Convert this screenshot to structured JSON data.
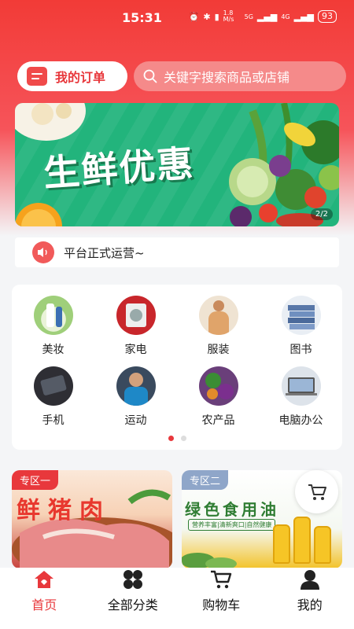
{
  "status_bar": {
    "time": "15:31",
    "network_speed": "1.8 M/s",
    "network_type": "5G",
    "network_type_2": "4G",
    "battery": "93"
  },
  "header": {
    "order_button_label": "我的订单",
    "search_placeholder": "关键字搜索商品或店铺"
  },
  "banner": {
    "title": "生鲜优惠",
    "page_indicator": "2/2"
  },
  "notice": {
    "text": "平台正式运营~"
  },
  "categories": [
    {
      "label": "美妆",
      "icon": "cosmetics-image"
    },
    {
      "label": "家电",
      "icon": "appliance-image"
    },
    {
      "label": "服装",
      "icon": "clothing-image"
    },
    {
      "label": "图书",
      "icon": "books-image"
    },
    {
      "label": "手机",
      "icon": "phone-image"
    },
    {
      "label": "运动",
      "icon": "sports-image"
    },
    {
      "label": "农产品",
      "icon": "produce-image"
    },
    {
      "label": "电脑办公",
      "icon": "computer-image"
    }
  ],
  "zones": [
    {
      "tag": "专区一",
      "title": "鲜猪肉"
    },
    {
      "tag": "专区二",
      "title": "绿色食用油",
      "subtitle": "营养丰富|清新爽口|自然健康"
    }
  ],
  "tab_bar": [
    {
      "label": "首页",
      "icon": "home-icon",
      "active": true
    },
    {
      "label": "全部分类",
      "icon": "grid-icon"
    },
    {
      "label": "购物车",
      "icon": "cart-icon"
    },
    {
      "label": "我的",
      "icon": "user-icon"
    }
  ],
  "colors": {
    "primary": "#e8383c",
    "banner_green": "#22b47c"
  }
}
